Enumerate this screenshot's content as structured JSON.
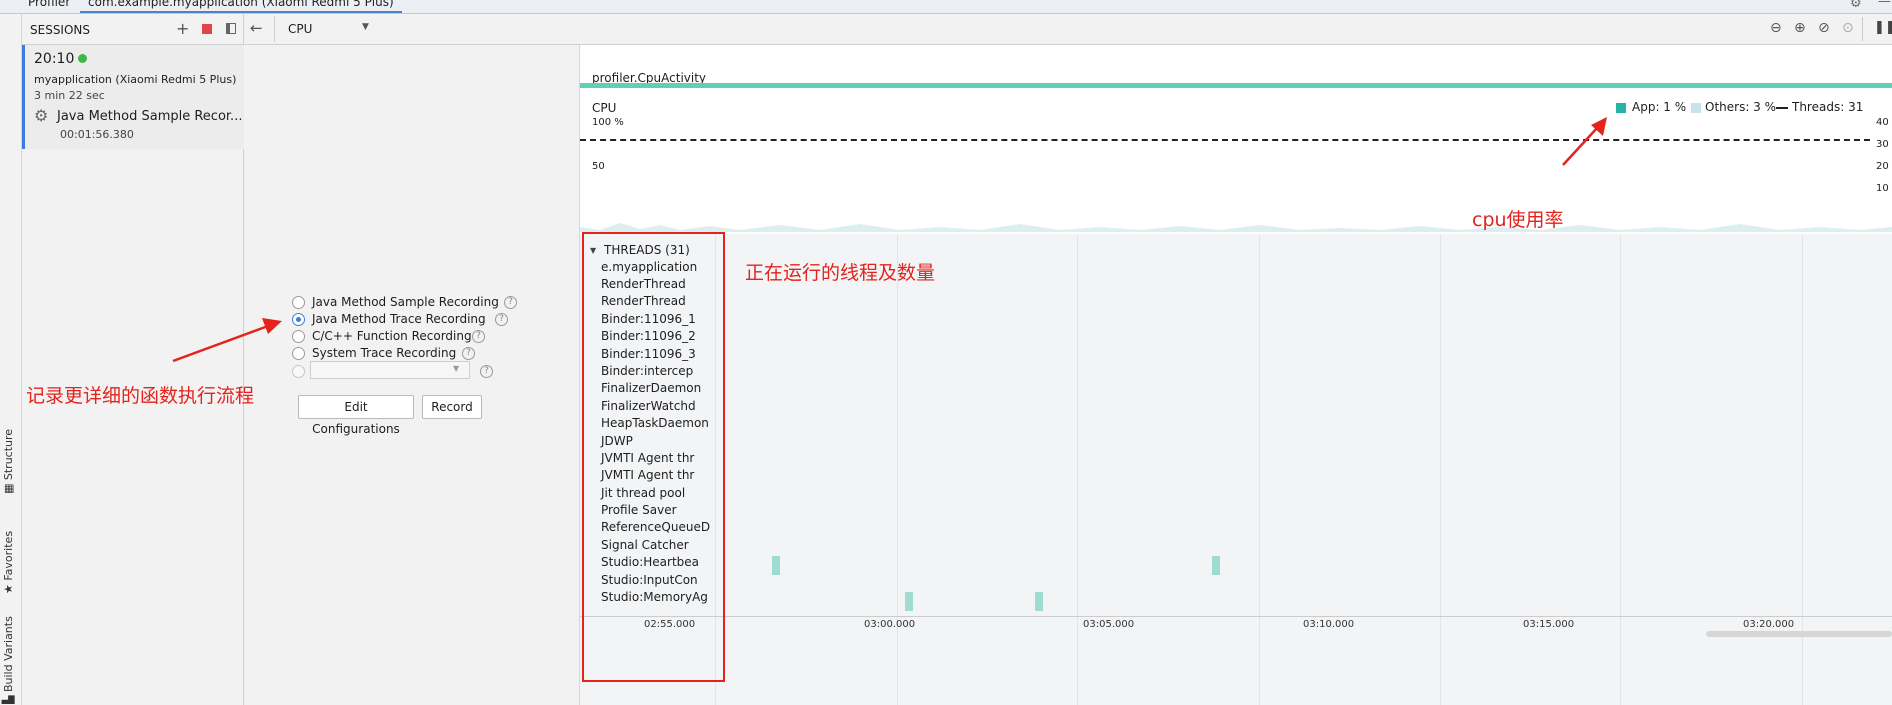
{
  "tabs": {
    "profiler": "Profiler",
    "session": "com.example.myapplication (Xiaomi Redmi 5 Plus)"
  },
  "left_strip": {
    "structure": "Structure",
    "favorites": "Favorites",
    "build_variants": "Build Variants"
  },
  "sessions": {
    "title": "SESSIONS",
    "time": "20:10",
    "app": "myapplication (Xiaomi Redmi 5 Plus)",
    "duration": "3 min 22 sec",
    "recording_name": "Java Method Sample Recor...",
    "recording_time": "00:01:56.380"
  },
  "cpu_toolbar": {
    "selector": "CPU"
  },
  "recording_options": [
    {
      "label": "Java Method Sample Recording",
      "selected": false
    },
    {
      "label": "Java Method Trace Recording",
      "selected": true
    },
    {
      "label": "C/C++ Function Recording",
      "selected": false
    },
    {
      "label": "System Trace Recording",
      "selected": false
    }
  ],
  "buttons": {
    "edit_configurations": "Edit Configurations",
    "record": "Record"
  },
  "timeline": {
    "activity": "profiler.CpuActivity",
    "cpu_label": "CPU",
    "y_100": "100 %",
    "y_50": "50",
    "right_axis": [
      "40",
      "30",
      "20",
      "10"
    ],
    "legend": {
      "app": "App: 1 %",
      "others": "Others: 3 %",
      "threads": "Threads: 31"
    },
    "threads_header": "THREADS (31)",
    "threads": [
      "e.myapplication",
      "RenderThread",
      "RenderThread",
      "Binder:11096_1",
      "Binder:11096_2",
      "Binder:11096_3",
      "Binder:intercep",
      "FinalizerDaemon",
      "FinalizerWatchd",
      "HeapTaskDaemon",
      "JDWP",
      "JVMTI Agent thr",
      "JVMTI Agent thr",
      "Jit thread pool",
      "Profile Saver",
      "ReferenceQueueD",
      "Signal Catcher",
      "Studio:Heartbea",
      "Studio:InputCon",
      "Studio:MemoryAg"
    ],
    "time_ticks": [
      "02:55.000",
      "03:00.000",
      "03:05.000",
      "03:10.000",
      "03:15.000",
      "03:20.000"
    ]
  },
  "annotations": {
    "record_detail": "记录更详细的函数执行流程",
    "threads_note": "正在运行的线程及数量",
    "cpu_usage": "cpu使用率"
  },
  "colors": {
    "accent": "#3d7be0",
    "activity": "#5ed1b4",
    "annotation": "#e4231d",
    "app_cpu": "#26b3a3",
    "others_cpu": "#c6e3ec"
  }
}
